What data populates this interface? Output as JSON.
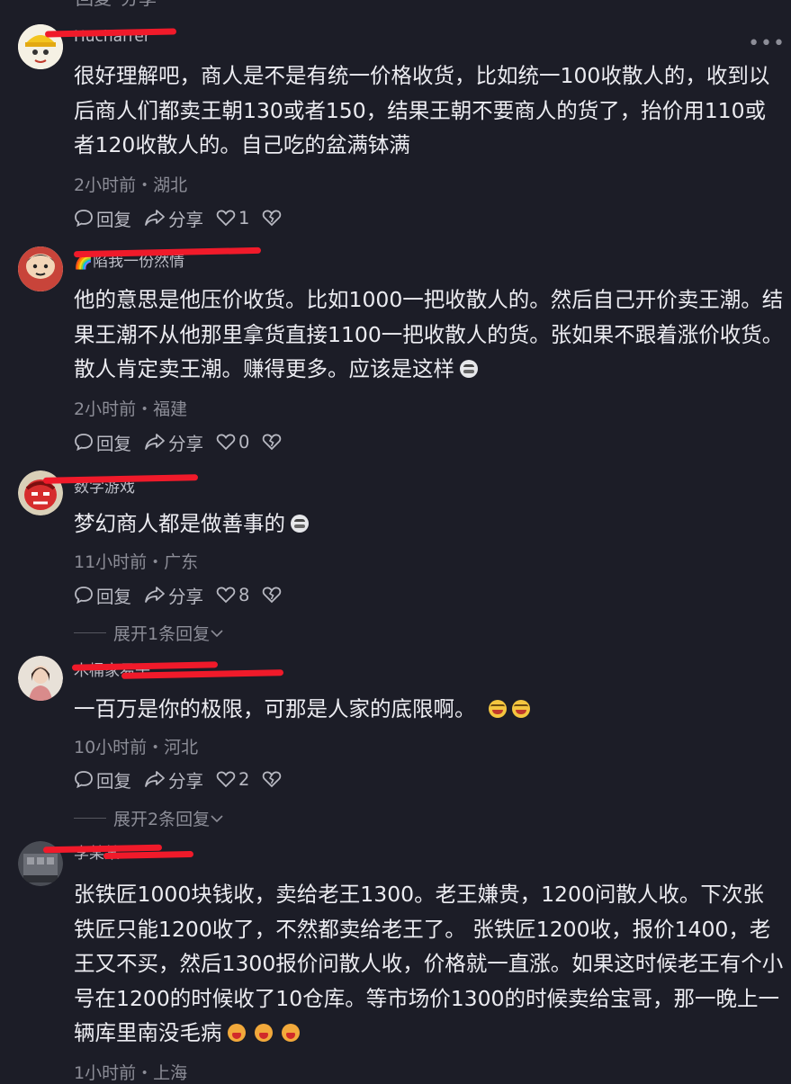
{
  "top_remnant": {
    "reply": "回复",
    "share": "分享"
  },
  "comments": [
    {
      "username": "Hucharrer",
      "text": "很好理解吧，商人是不是有统一价格收货，比如统一100收散人的，收到以后商人们都卖王朝130或者150，结果王朝不要商人的货了，抬价用110或者120收散人的。自己吃的盆满钵满",
      "meta": "2小时前・湖北",
      "reply_label": "回复",
      "share_label": "分享",
      "likes": "1"
    },
    {
      "username": "🌈陷我一份然情",
      "text": "他的意思是他压价收货。比如1000一把收散人的。然后自己开价卖王潮。结果王潮不从他那里拿货直接1100一把收散人的货。张如果不跟着涨价收货。散人肯定卖王潮。赚得更多。应该是这样",
      "meta": "2小时前・福建",
      "reply_label": "回复",
      "share_label": "分享",
      "likes": "0"
    },
    {
      "username": "数字游戏",
      "text": "梦幻商人都是做善事的",
      "meta": "11小时前・广东",
      "reply_label": "回复",
      "share_label": "分享",
      "likes": "8",
      "expand": "展开1条回复"
    },
    {
      "username": "木桶家易子",
      "text": "一百万是你的极限，可那是人家的底限啊。",
      "meta": "10小时前・河北",
      "reply_label": "回复",
      "share_label": "分享",
      "likes": "2",
      "expand": "展开2条回复"
    },
    {
      "username": "李某某",
      "text": "张铁匠1000块钱收，卖给老王1300。老王嫌贵，1200问散人收。下次张铁匠只能1200收了，不然都卖给老王了。 张铁匠1200收，报价1400，老王又不买，然后1300报价问散人收，价格就一直涨。如果这时候老王有个小号在1200的时候收了10仓库。等市场价1300的时候卖给宝哥，那一晚上一辆库里南没毛病",
      "meta": "1小时前・上海"
    }
  ],
  "colors": {
    "background": "#1c1d27",
    "text": "#ececf1",
    "secondary": "#8c8d97",
    "redaction": "#f01a2a"
  },
  "icons": {
    "reply": "comment-bubble-icon",
    "share": "share-arrow-icon",
    "like": "heart-icon",
    "dislike": "broken-heart-icon",
    "more": "more-dots-icon",
    "expand": "chevron-down-icon"
  }
}
